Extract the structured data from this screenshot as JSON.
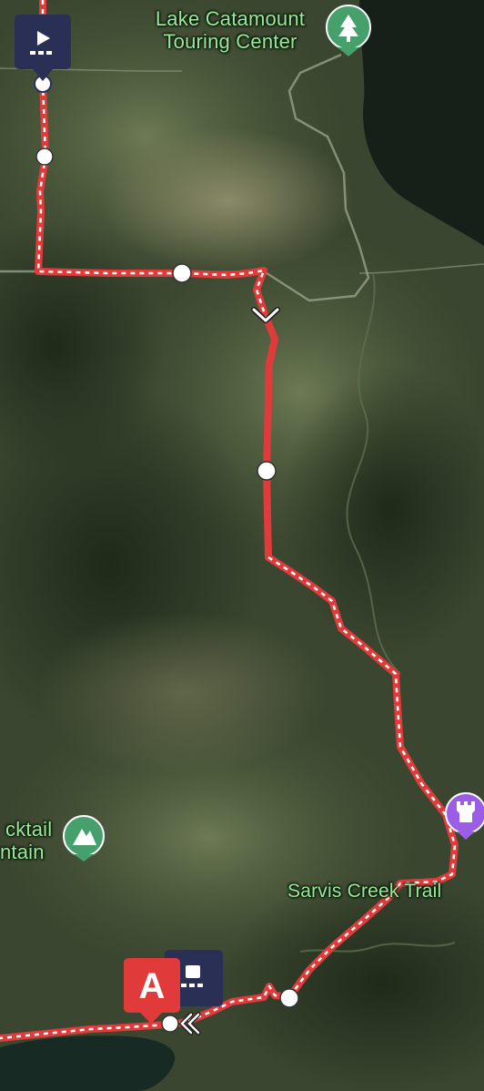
{
  "labels": {
    "lake_catamount_line1": "Lake Catamount",
    "lake_catamount_line2": "Touring Center",
    "rocktail_line1": "cktail",
    "rocktail_line2": "ntain",
    "sarvis_creek": "Sarvis Creek Trail"
  },
  "markers": {
    "start_letter": "A"
  },
  "colors": {
    "route": "#e03a3a",
    "route_dash": "#ffffff",
    "flag_navy": "#2a2f55",
    "poi_green": "#46a06b",
    "poi_purple": "#9b5de5",
    "start_red": "#e03a3a"
  },
  "icons": {
    "start_flag": "play-flag-icon",
    "end_flag": "stop-flag-icon",
    "tree_poi": "tree-icon",
    "mountain_poi": "mountain-icon",
    "castle_poi": "castle-icon",
    "direction_chevron": "chevron-down-icon",
    "back_chevron": "chevron-left-double-icon"
  }
}
